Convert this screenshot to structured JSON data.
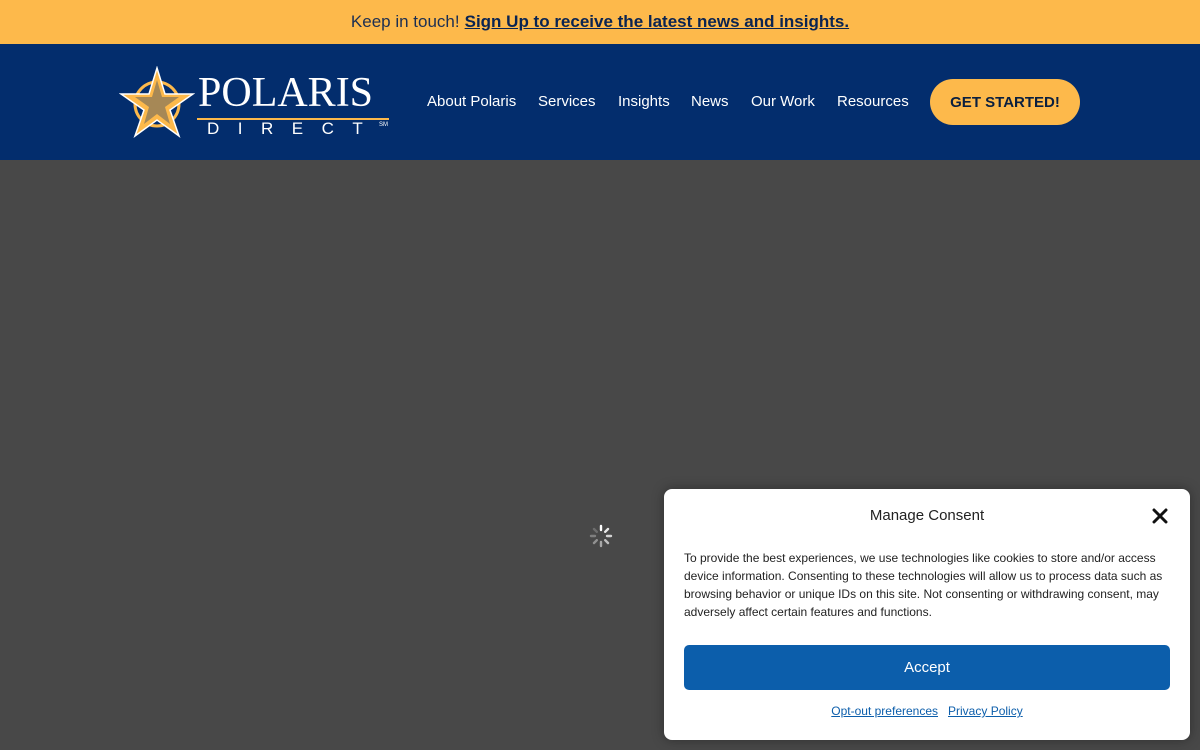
{
  "topbar": {
    "lead": "Keep in touch!",
    "link": "Sign Up to receive the latest news and insights.",
    "background": "#fdb94b"
  },
  "header": {
    "background": "#032d6d",
    "logo": {
      "word": "POLARIS",
      "sub": "DIRECT",
      "mark": "SM",
      "icon": "star-icon"
    },
    "nav": [
      "About Polaris",
      "Services",
      "Insights",
      "News",
      "Our Work",
      "Resources"
    ],
    "cta": "GET STARTED!"
  },
  "main": {
    "loading_icon": "spinner-icon"
  },
  "consent": {
    "title": "Manage Consent",
    "text": "To provide the best experiences, we use technologies like cookies to store and/or access device information. Consenting to these technologies will allow us to process data such as browsing behavior or unique IDs on this site. Not consenting or withdrawing consent, may adversely affect certain features and functions.",
    "accept": "Accept",
    "links": [
      "Opt-out preferences",
      "Privacy Policy"
    ],
    "close_icon": "close-icon",
    "accent": "#0c5eab"
  }
}
